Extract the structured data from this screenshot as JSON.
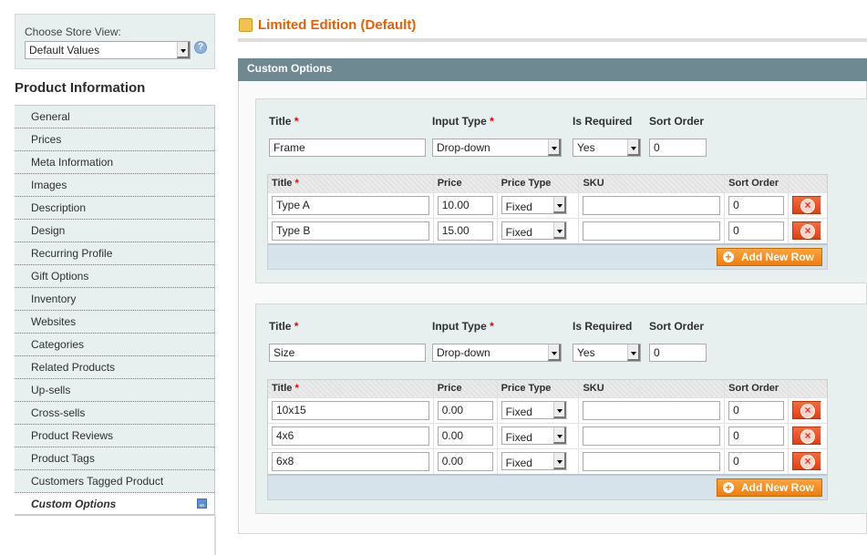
{
  "store_switcher": {
    "label": "Choose Store View:",
    "value": "Default Values",
    "help_icon": "help-icon"
  },
  "sidebar": {
    "title": "Product Information",
    "items": [
      {
        "label": "General"
      },
      {
        "label": "Prices"
      },
      {
        "label": "Meta Information"
      },
      {
        "label": "Images"
      },
      {
        "label": "Description"
      },
      {
        "label": "Design"
      },
      {
        "label": "Recurring Profile"
      },
      {
        "label": "Gift Options"
      },
      {
        "label": "Inventory"
      },
      {
        "label": "Websites"
      },
      {
        "label": "Categories"
      },
      {
        "label": "Related Products"
      },
      {
        "label": "Up-sells"
      },
      {
        "label": "Cross-sells"
      },
      {
        "label": "Product Reviews"
      },
      {
        "label": "Product Tags"
      },
      {
        "label": "Customers Tagged Product"
      },
      {
        "label": "Custom Options",
        "active": true
      }
    ]
  },
  "page": {
    "title": "Limited Edition (Default)",
    "section": "Custom Options"
  },
  "labels": {
    "title": "Title",
    "required_mark": "*",
    "input_type": "Input Type",
    "is_required": "Is Required",
    "sort_order": "Sort Order",
    "col_title": "Title",
    "col_price": "Price",
    "col_price_type": "Price Type",
    "col_sku": "SKU",
    "col_sort": "Sort Order",
    "add_row": "Add New Row"
  },
  "options": [
    {
      "title": "Frame",
      "input_type": "Drop-down",
      "is_required": "Yes",
      "sort_order": "0",
      "rows": [
        {
          "title": "Type A",
          "price": "10.00",
          "price_type": "Fixed",
          "sku": "",
          "sort": "0"
        },
        {
          "title": "Type B",
          "price": "15.00",
          "price_type": "Fixed",
          "sku": "",
          "sort": "0"
        }
      ]
    },
    {
      "title": "Size",
      "input_type": "Drop-down",
      "is_required": "Yes",
      "sort_order": "0",
      "rows": [
        {
          "title": "10x15",
          "price": "0.00",
          "price_type": "Fixed",
          "sku": "",
          "sort": "0"
        },
        {
          "title": "4x6",
          "price": "0.00",
          "price_type": "Fixed",
          "sku": "",
          "sort": "0"
        },
        {
          "title": "6x8",
          "price": "0.00",
          "price_type": "Fixed",
          "sku": "",
          "sort": "0"
        }
      ]
    }
  ],
  "colors": {
    "accent": "#eb5e00",
    "section_header": "#6f8992",
    "panel": "#e7efef",
    "button": "#f07d10"
  }
}
